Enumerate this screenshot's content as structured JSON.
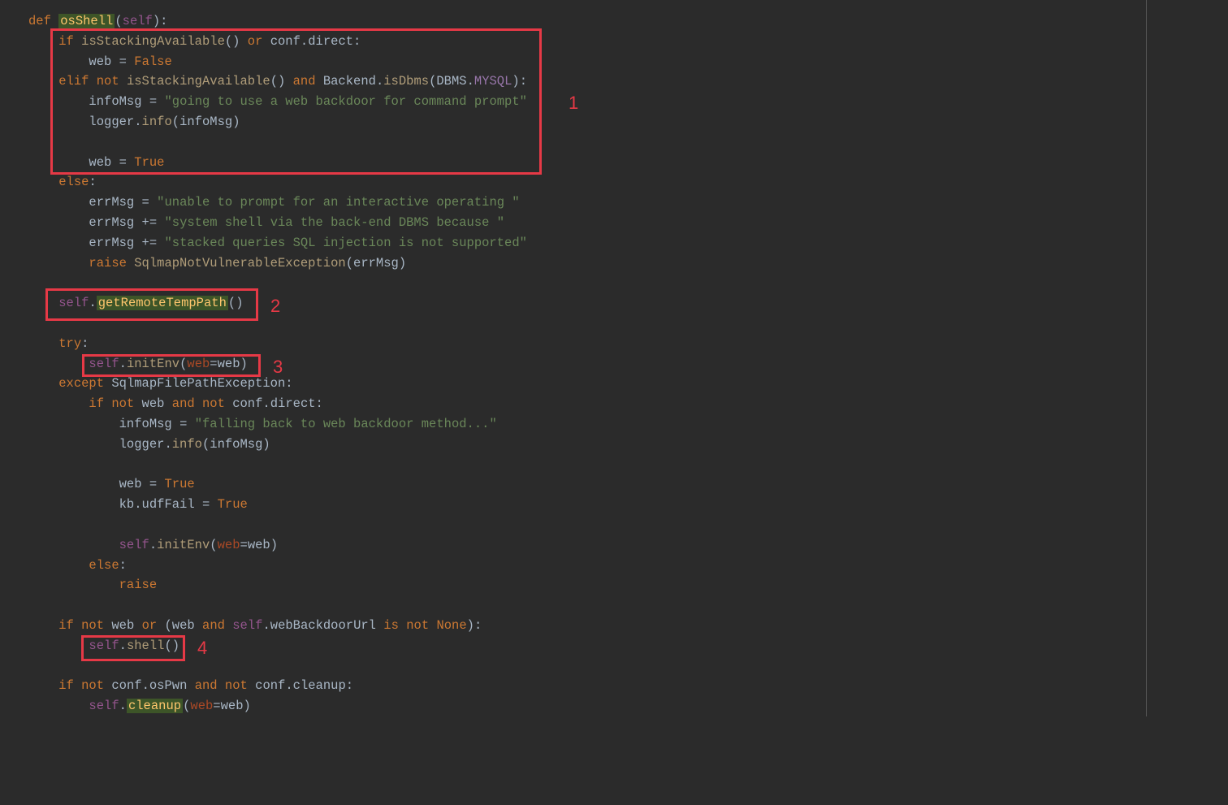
{
  "annotations": {
    "a1": "1",
    "a2": "2",
    "a3": "3",
    "a4": "4"
  },
  "code": {
    "l1_def": "def",
    "l1_fn": "osShell",
    "l1_self": "self",
    "l2_if": "if",
    "l2_fn": "isStackingAvailable",
    "l2_or": "or",
    "l2_conf": "conf",
    "l2_direct": "direct",
    "l3_web": "web",
    "l3_eq": "=",
    "l3_false": "False",
    "l4_elif": "elif not",
    "l4_fn": "isStackingAvailable",
    "l4_and": "and",
    "l4_backend": "Backend",
    "l4_isdbms": "isDbms",
    "l4_dbms": "DBMS",
    "l4_mysql": "MYSQL",
    "l5_infomsg": "infoMsg",
    "l5_str": "\"going to use a web backdoor for command prompt\"",
    "l6_logger": "logger",
    "l6_info": "info",
    "l6_arg": "infoMsg",
    "l8_web": "web",
    "l8_true": "True",
    "l9_else": "else",
    "l10_errmsg": "errMsg",
    "l10_str": "\"unable to prompt for an interactive operating \"",
    "l11_errmsg": "errMsg",
    "l11_op": "+=",
    "l11_str": "\"system shell via the back-end DBMS because \"",
    "l12_errmsg": "errMsg",
    "l12_op": "+=",
    "l12_str": "\"stacked queries SQL injection is not supported\"",
    "l13_raise": "raise",
    "l13_exc": "SqlmapNotVulnerableException",
    "l13_arg": "errMsg",
    "l15_self": "self",
    "l15_method": "getRemoteTempPath",
    "l17_try": "try",
    "l18_self": "self",
    "l18_method": "initEnv",
    "l18_kw": "web",
    "l18_arg": "web",
    "l19_except": "except",
    "l19_exc": "SqlmapFilePathException",
    "l20_if": "if not",
    "l20_web": "web",
    "l20_and": "and not",
    "l20_conf": "conf",
    "l20_direct": "direct",
    "l21_infomsg": "infoMsg",
    "l21_str": "\"falling back to web backdoor method...\"",
    "l22_logger": "logger",
    "l22_info": "info",
    "l22_arg": "infoMsg",
    "l24_web": "web",
    "l24_true": "True",
    "l25_kb": "kb",
    "l25_udf": "udfFail",
    "l25_true": "True",
    "l27_self": "self",
    "l27_method": "initEnv",
    "l27_kw": "web",
    "l27_arg": "web",
    "l28_else": "else",
    "l29_raise": "raise",
    "l31_if": "if not",
    "l31_web": "web",
    "l31_or": "or",
    "l31_web2": "web",
    "l31_and": "and",
    "l31_self": "self",
    "l31_url": "webBackdoorUrl",
    "l31_isnot": "is not",
    "l31_none": "None",
    "l32_self": "self",
    "l32_shell": "shell",
    "l34_if": "if not",
    "l34_conf": "conf",
    "l34_ospwn": "osPwn",
    "l34_and": "and not",
    "l34_conf2": "conf",
    "l34_cleanup": "cleanup",
    "l35_self": "self",
    "l35_cleanup": "cleanup",
    "l35_kw": "web",
    "l35_arg": "web"
  }
}
